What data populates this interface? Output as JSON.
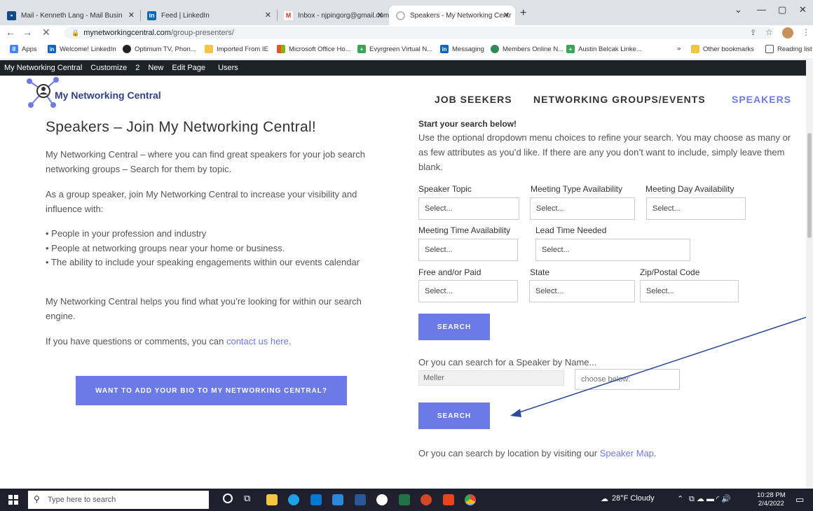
{
  "browser": {
    "tabs": [
      {
        "label": "Mail - Kenneth Lang - Mail Busin",
        "icon": "outlook-icon",
        "color": "#0f4a8a"
      },
      {
        "label": "Feed | LinkedIn",
        "icon": "linkedin-icon",
        "color": "#0a66c2"
      },
      {
        "label": "Inbox - njpingorg@gmail.com - ",
        "icon": "gmail-icon",
        "color": "#d93025"
      },
      {
        "label": "Speakers - My Networking Centr",
        "icon": "loading-icon",
        "color": "#999999"
      }
    ],
    "new_tab": "+",
    "url_domain": "mynetworkingcentral.com",
    "url_path": "/group-presenters/",
    "bookmarks": [
      {
        "label": "Apps",
        "color": "#4285f4"
      },
      {
        "label": "Welcome! LinkedIn",
        "color": "#0a66c2"
      },
      {
        "label": "Optimum TV, Phon...",
        "color": "#222222"
      },
      {
        "label": "Imported From IE",
        "color": "#f4c542"
      },
      {
        "label": "Microsoft Office Ho...",
        "color": "#e74c3c"
      },
      {
        "label": "Evyrgreen Virtual N...",
        "color": "#3aa757"
      },
      {
        "label": "Messaging",
        "color": "#0a66c2"
      },
      {
        "label": "Members Online N...",
        "color": "#2e8b57"
      },
      {
        "label": "Austin Belcak Linke...",
        "color": "#3aa757"
      }
    ],
    "bookmarks_more": "»",
    "other_bookmarks": "Other bookmarks",
    "reading_list": "Reading list"
  },
  "wpbar": {
    "site": "My Networking Central",
    "customize": "Customize",
    "comments": "2",
    "new": "New",
    "edit": "Edit Page",
    "users": "Users"
  },
  "site": {
    "logo_text": "My Networking Central",
    "nav": [
      "JOB SEEKERS",
      "NETWORKING GROUPS/EVENTS",
      "SPEAKERS"
    ]
  },
  "left": {
    "title": "Speakers  – Join My Networking Central!",
    "p1": "My Networking Central – where you can find great speakers for your job search networking groups – Search for them by topic.",
    "p2": "As a group speaker, join My Networking Central to increase your visibility and influence with:",
    "bullets": [
      "• People in your profession and industry",
      "• People at networking groups near your home or business.",
      "• The ability to include your speaking engagements within our events calendar"
    ],
    "p3": "My Networking Central helps you find what you’re looking for within our search engine.",
    "p4_prefix": "If you have questions or comments, you can ",
    "p4_link": "contact us here",
    "p4_suffix": ".",
    "bio_button": "WANT TO ADD YOUR BIO TO MY NETWORKING CENTRAL?"
  },
  "right": {
    "heading": "Start your search below!",
    "intro": "Use the optional dropdown menu choices to refine your search. You may choose as many or as few attributes as you’d like. If there are any you don’t want to include, simply leave them blank.",
    "labels": {
      "topic": "Speaker Topic",
      "type": "Meeting Type Availability",
      "day": "Meeting Day Availability",
      "time": "Meeting Time Availability",
      "lead": "Lead Time Needed",
      "free": "Free and/or Paid",
      "state": "State",
      "zip": "Zip/Postal Code"
    },
    "select_placeholder": "Select...",
    "search_button": "SEARCH",
    "by_name": "Or you can search for a Speaker by Name...",
    "name_value": "Meller",
    "choose_below": "choose below:",
    "map_prefix": "Or you can search by location by visiting our ",
    "map_link": "Speaker Map",
    "map_suffix": "."
  },
  "taskbar": {
    "search_placeholder": "Type here to search",
    "weather": "28°F Cloudy",
    "time": "10:28 PM",
    "date": "2/4/2022"
  }
}
